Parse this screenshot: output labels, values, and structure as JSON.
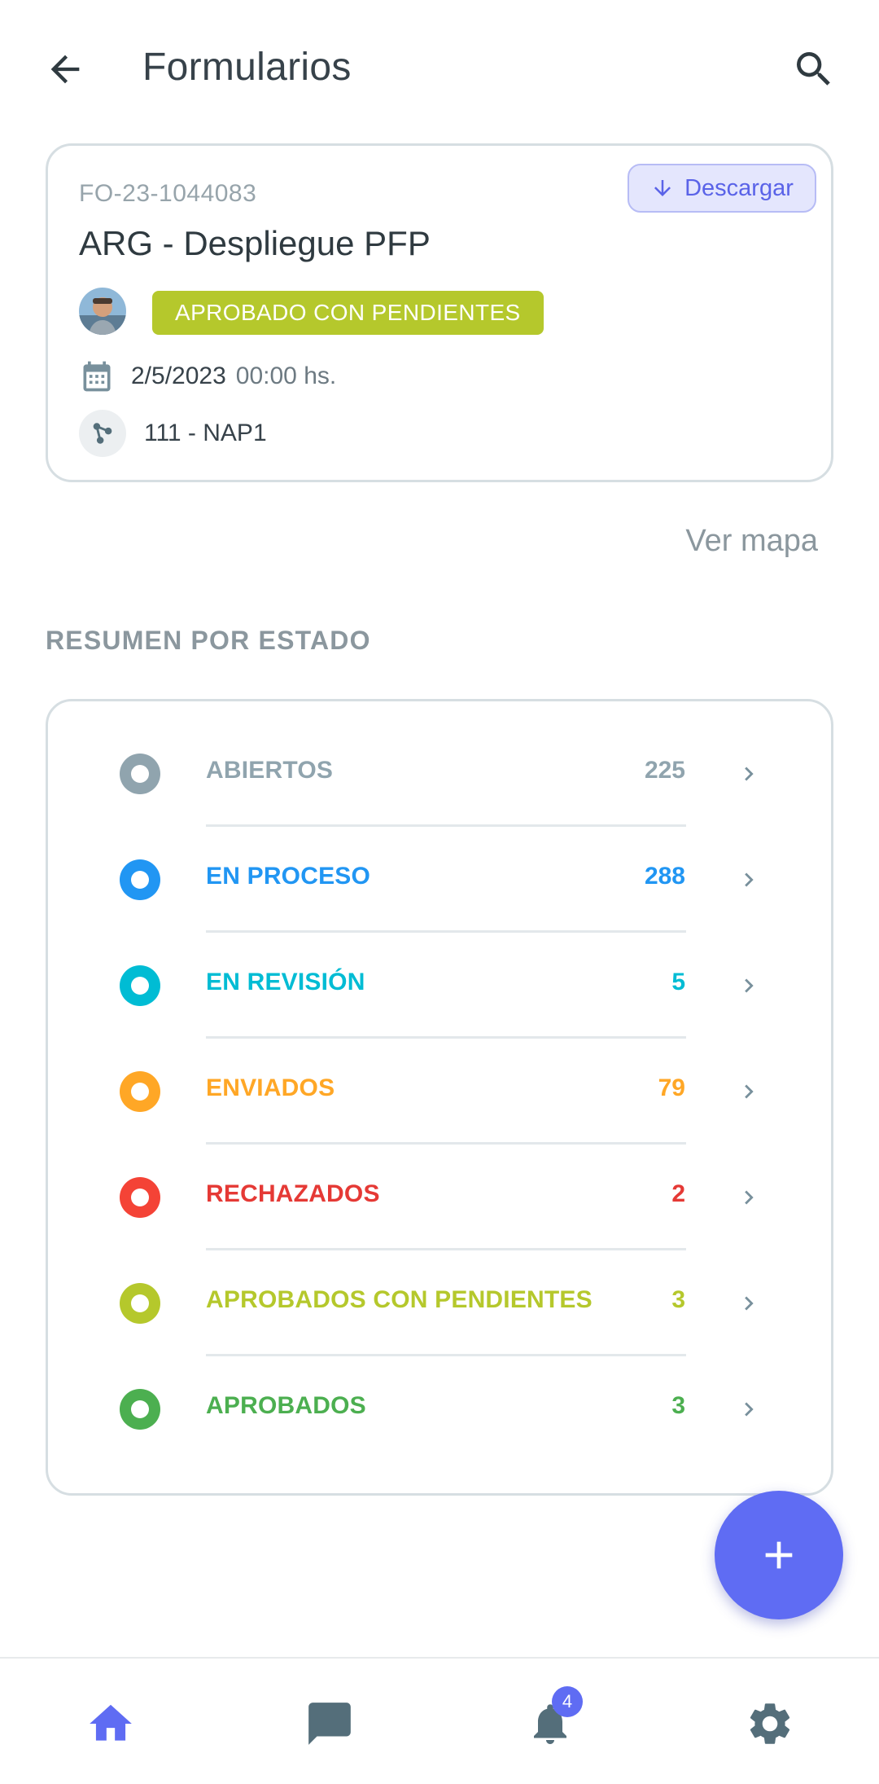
{
  "header": {
    "title": "Formularios",
    "back_icon": "arrow-left-icon",
    "search_icon": "search-icon"
  },
  "form": {
    "code": "FO-23-1044083",
    "name": "ARG - Despliegue PFP",
    "download_label": "Descargar",
    "status": "APROBADO CON PENDIENTES",
    "status_color": "#b5c82c",
    "date": "2/5/2023",
    "time": "00:00 hs.",
    "site": "111 - NAP1"
  },
  "ver_mapa_label": "Ver mapa",
  "summary": {
    "title": "RESUMEN POR ESTADO",
    "items": [
      {
        "label": "ABIERTOS",
        "count": "225",
        "color": "#90a4ae"
      },
      {
        "label": "EN PROCESO",
        "count": "288",
        "color": "#2196f3"
      },
      {
        "label": "EN REVISIÓN",
        "count": "5",
        "color": "#00bcd4"
      },
      {
        "label": "ENVIADOS",
        "count": "79",
        "color": "#ffa726"
      },
      {
        "label": "RECHAZADOS",
        "count": "2",
        "color": "#f44336"
      },
      {
        "label": "APROBADOS CON PENDIENTES",
        "count": "3",
        "color": "#b5c82c"
      },
      {
        "label": "APROBADOS",
        "count": "3",
        "color": "#4caf50"
      }
    ]
  },
  "fab_icon": "plus-icon",
  "bottom_nav": {
    "items": [
      {
        "icon": "home-icon",
        "active": true
      },
      {
        "icon": "chat-icon",
        "active": false
      },
      {
        "icon": "bell-icon",
        "active": false
      },
      {
        "icon": "gear-icon",
        "active": false
      }
    ],
    "notification_count": "4",
    "active_color": "#5f6cf3",
    "inactive_color": "#546e7a"
  }
}
